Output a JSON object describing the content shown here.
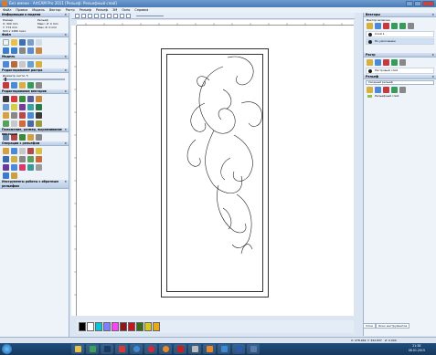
{
  "app": {
    "title": "Без имени - ArtCAM Pro 2011 [Рельеф: Рельефный слой]"
  },
  "menu": [
    "Файл",
    "Правка",
    "Модель",
    "Вектор",
    "Растр",
    "Рельеф",
    "Рельеф",
    "ЗМ",
    "Окно",
    "Справка"
  ],
  "left": {
    "info_header": "Информация о модели",
    "size_label": "Размер",
    "size_x": "X: 300 mm",
    "size_y": "Y: 774 mm",
    "relief_label": "Рельеф",
    "max_z": "Макс: Z: 0 mm",
    "min_z": "Мин: Z: 0 mm",
    "pixels": "820 x 1480 пикс",
    "file_header": "Файл",
    "model_header": "Модель",
    "raster_header": "Редактирование растра",
    "brush_label": "Диаметр кисти: 5",
    "vector_header": "Редактирование векторов",
    "position_header": "Положение, размер, выравнивание векторов",
    "relief_header": "Операции с рельефом",
    "tools_header": "Инструменты работы с обратным рельефом",
    "tabs": [
      "Проект",
      "Помощник",
      "Траектории"
    ]
  },
  "right": {
    "vectors_header": "Векторы",
    "vectors_sub": "Вектор включен",
    "vector_layers": [
      "Слой 1",
      "По умолчанию"
    ],
    "raster_header": "Растр",
    "raster_layer": "Растровый слой",
    "relief_header": "Рельеф",
    "relief_select": "Сводный рельеф",
    "relief_layer": "Рельефный слой",
    "tabs": [
      "Слои",
      "Окно инструментов"
    ]
  },
  "status": {
    "x": "X: 278.049",
    "y": "Y: 342.837",
    "z": "Z: 0.000"
  },
  "palette": [
    "#000000",
    "#ffffff",
    "#00c8d8",
    "#7f7fff",
    "#ff40ff",
    "#8b1a1a",
    "#c8141e",
    "#3a6b1a",
    "#d8c81e",
    "#e8a818"
  ],
  "taskbar": {
    "time": "21:38",
    "date": "06.01.2015"
  }
}
